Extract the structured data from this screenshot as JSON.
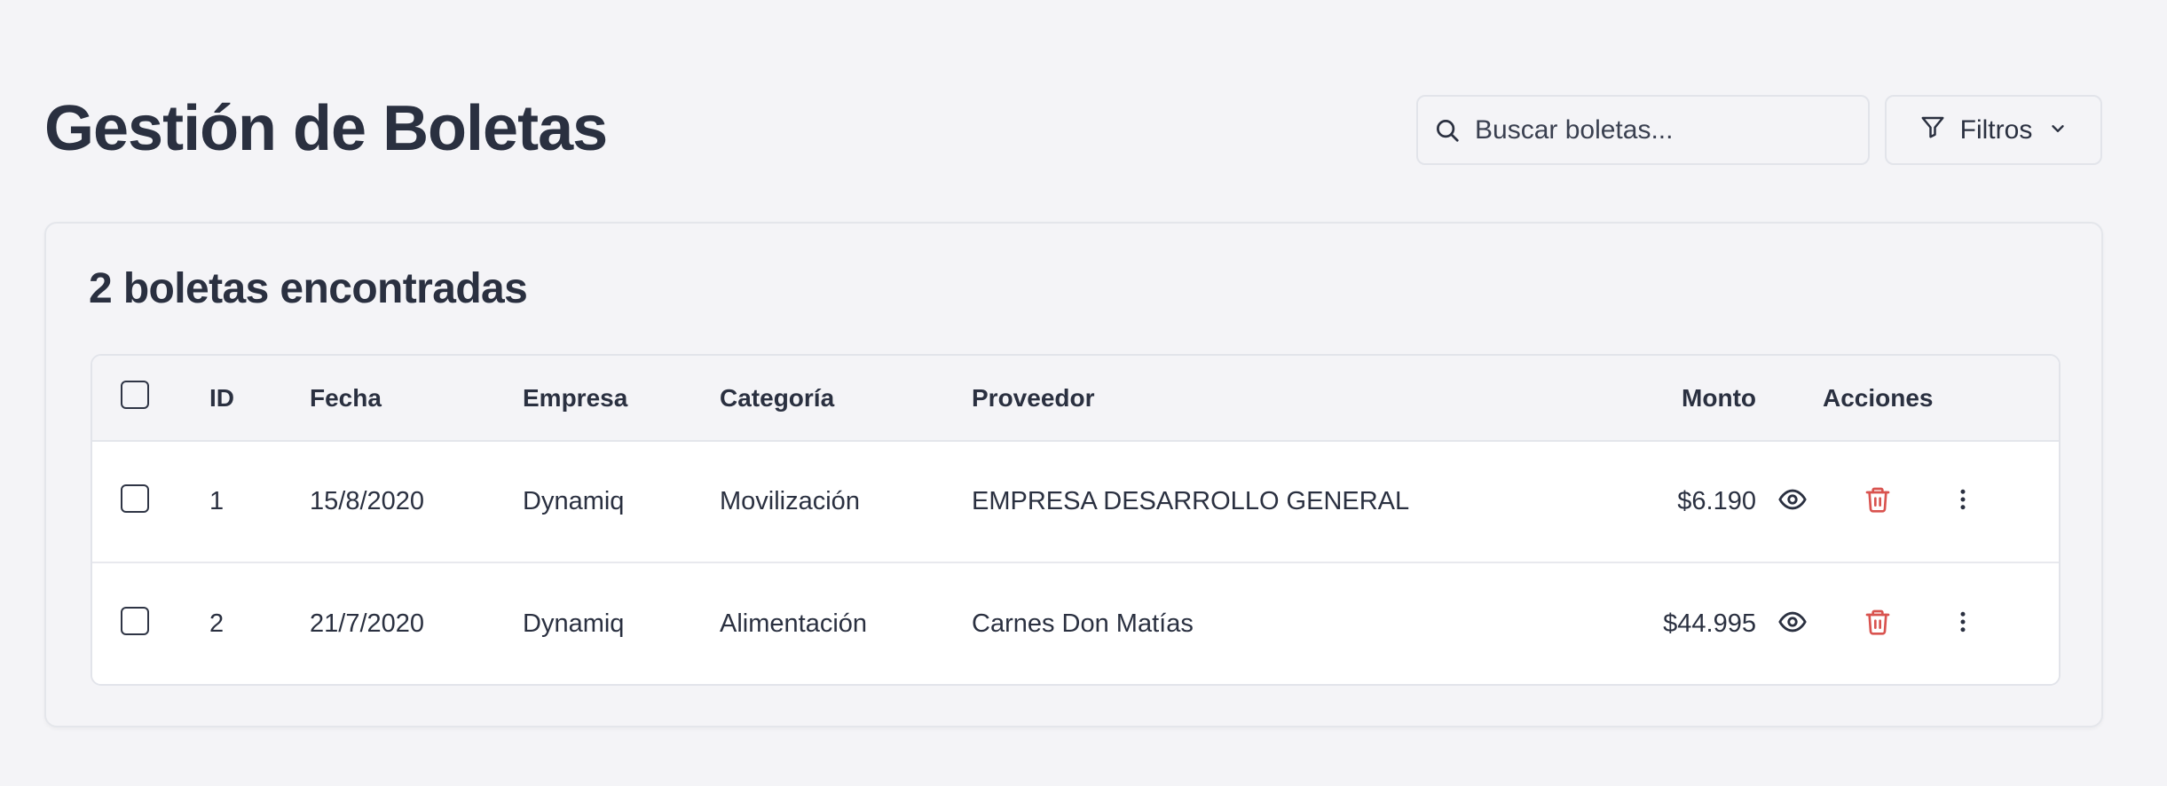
{
  "header": {
    "title": "Gestión de Boletas",
    "search": {
      "placeholder": "Buscar boletas...",
      "value": ""
    },
    "filters_label": "Filtros"
  },
  "results": {
    "count_label": "2 boletas encontradas"
  },
  "table": {
    "columns": [
      "ID",
      "Fecha",
      "Empresa",
      "Categoría",
      "Proveedor",
      "Monto",
      "Acciones"
    ],
    "rows": [
      {
        "id": "1",
        "fecha": "15/8/2020",
        "empresa": "Dynamiq",
        "categoria": "Movilización",
        "proveedor": "EMPRESA DESARROLLO GENERAL",
        "monto": "$6.190"
      },
      {
        "id": "2",
        "fecha": "21/7/2020",
        "empresa": "Dynamiq",
        "categoria": "Alimentación",
        "proveedor": "Carnes Don Matías",
        "monto": "$44.995"
      }
    ]
  },
  "icons": {
    "search": "search-icon",
    "filter": "filter-icon",
    "chevron": "chevron-down-icon",
    "view": "eye-icon",
    "delete": "trash-icon",
    "more": "more-vertical-icon"
  },
  "colors": {
    "background": "#f4f4f7",
    "text": "#2a3040",
    "danger": "#d9534f",
    "border": "#e2e4ea"
  }
}
